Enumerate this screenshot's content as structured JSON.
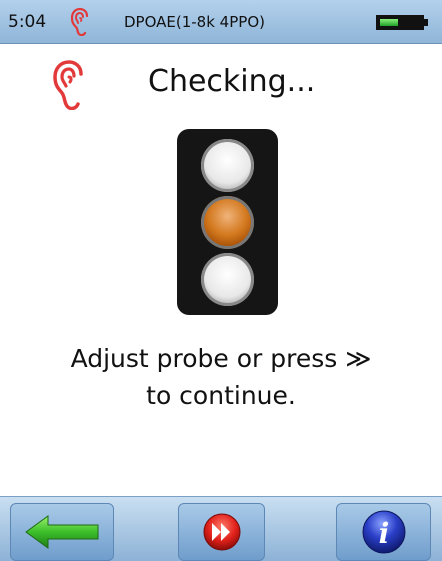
{
  "status_bar": {
    "time": "5:04",
    "title": "DPOAE(1-8k 4PPO)",
    "battery_level_fraction": 0.4,
    "ear_icon": "right-ear-icon",
    "ear_color": "#e23a3a"
  },
  "main": {
    "status_text": "Checking...",
    "ear_icon": "right-ear-icon",
    "traffic_light": {
      "active_lamp": "middle",
      "active_color": "#d3791f"
    },
    "instruction_line1": "Adjust probe or press ≫",
    "instruction_line2": "to continue."
  },
  "toolbar": {
    "back_icon": "back-arrow-icon",
    "continue_icon": "fast-forward-icon",
    "info_icon": "info-icon"
  }
}
